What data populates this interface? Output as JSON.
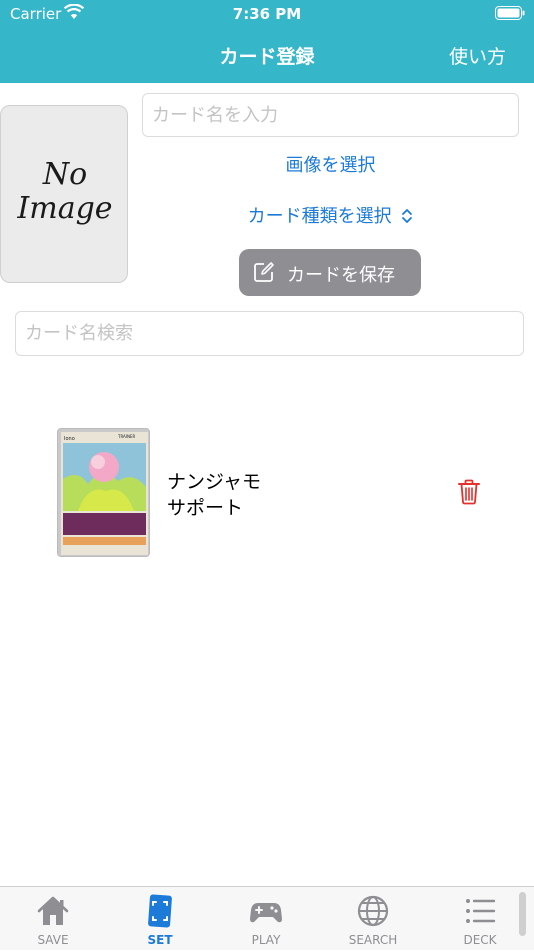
{
  "status_bar": {
    "carrier": "Carrier",
    "time": "7:36 PM"
  },
  "header": {
    "title": "カード登録",
    "help_label": "使い方"
  },
  "image_placeholder": {
    "line1": "No",
    "line2": "Image"
  },
  "form": {
    "name_placeholder": "カード名を入力",
    "select_image_label": "画像を選択",
    "select_type_label": "カード種類を選択",
    "save_label": "カードを保存"
  },
  "search": {
    "placeholder": "カード名検索"
  },
  "cards": [
    {
      "name": "ナンジャモ",
      "type": "サポート",
      "card_title": "Iono",
      "card_category": "TRAINER"
    }
  ],
  "tabs": [
    {
      "label": "SAVE",
      "icon": "house-icon",
      "active": false
    },
    {
      "label": "SET",
      "icon": "card-scan-icon",
      "active": true
    },
    {
      "label": "PLAY",
      "icon": "gamepad-icon",
      "active": false
    },
    {
      "label": "SEARCH",
      "icon": "globe-icon",
      "active": false
    },
    {
      "label": "DECK",
      "icon": "list-icon",
      "active": false
    }
  ],
  "colors": {
    "header": "#36b6c9",
    "accent": "#1c7ad8",
    "delete": "#e5302b",
    "save_button": "#8e8e93"
  }
}
